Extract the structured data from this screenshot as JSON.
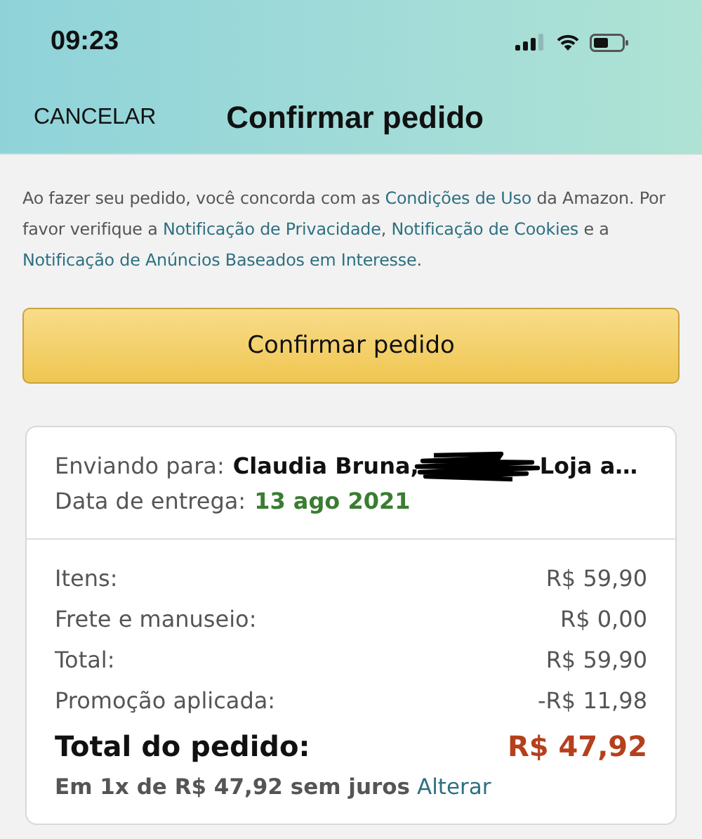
{
  "status_bar": {
    "time": "09:23"
  },
  "nav": {
    "cancel": "CANCELAR",
    "title": "Confirmar pedido"
  },
  "notice": [
    {
      "text": "Ao fazer seu pedido, você concorda com as ",
      "link": false
    },
    {
      "text": "Condições de Uso",
      "link": true
    },
    {
      "text": " da Amazon. Por favor verifique a ",
      "link": false
    },
    {
      "text": "Notificação de Privacidade",
      "link": true
    },
    {
      "text": ", ",
      "link": false
    },
    {
      "text": "Notificação de Cookies",
      "link": true
    },
    {
      "text": " e a ",
      "link": false
    },
    {
      "text": "Notificação de Anúncios Baseados em Interesse",
      "link": true
    },
    {
      "text": ".",
      "link": false
    }
  ],
  "confirm_button": "Confirmar pedido",
  "shipping": {
    "label": "Enviando para:",
    "name": "Claudia Bruna,",
    "redacted": true,
    "address": "Loja a…"
  },
  "delivery": {
    "label": "Data de entrega:",
    "date": "13 ago 2021"
  },
  "summary": [
    {
      "label": "Itens:",
      "value": "R$ 59,90"
    },
    {
      "label": "Frete e manuseio:",
      "value": "R$ 0,00"
    },
    {
      "label": "Total:",
      "value": "R$ 59,90"
    },
    {
      "label": "Promoção aplicada:",
      "value": "-R$ 11,98"
    }
  ],
  "order_total": {
    "label": "Total do pedido:",
    "value": "R$ 47,92"
  },
  "installment": {
    "text": "Em 1x de R$ 47,92 sem juros",
    "link": "Alterar"
  }
}
